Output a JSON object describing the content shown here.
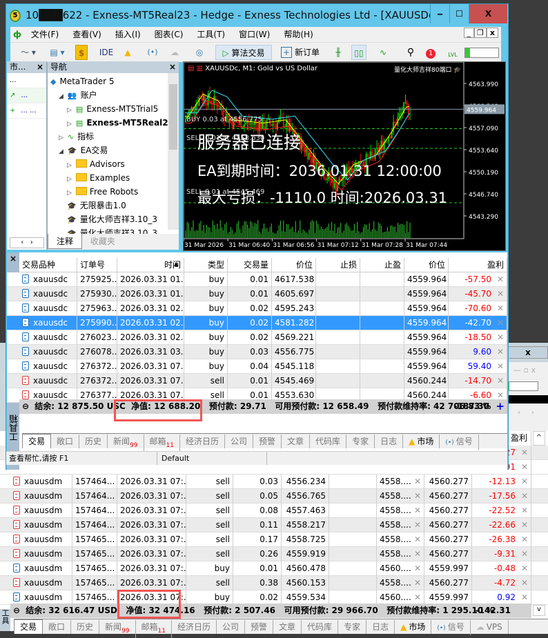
{
  "window": {
    "title": "10███622 - Exness-MT5Real23 - Hedge - Exness Technologies Ltd - [XAUUSDc,...",
    "min": "‒",
    "max": "☐",
    "close": "X"
  },
  "menu": [
    "文件(F)",
    "查看(V)",
    "插入(I)",
    "图表(C)",
    "工具(T)",
    "窗口(W)",
    "帮助(H)"
  ],
  "toolbar": {
    "ide": "IDE",
    "algo": "算法交易",
    "new_order": "新订单",
    "lvl": "LVL",
    "notif_count": "1",
    "level_fill_pct": 15
  },
  "market_watch": {
    "title": "市...",
    "rows": [
      [
        "...",
        ""
      ],
      [
        "↗",
        "..."
      ],
      [
        "+",
        "... ..."
      ]
    ]
  },
  "navigator": {
    "title": "导航",
    "tabs": [
      "注释",
      "收藏夹"
    ],
    "items": [
      {
        "label": "MetaTrader 5",
        "icon": "mt5-logo-icon",
        "level": 0
      },
      {
        "label": "账户",
        "icon": "accounts-icon",
        "level": 1,
        "expand": "◢"
      },
      {
        "label": "Exness-MT5Trial5",
        "icon": "server-icon",
        "level": 2,
        "expand": "▷"
      },
      {
        "label": "Exness-MT5Real2",
        "icon": "server-icon",
        "level": 2,
        "expand": "▷",
        "bold": true
      },
      {
        "label": "指标",
        "icon": "indicator-icon",
        "level": 1,
        "expand": "▷"
      },
      {
        "label": "EA交易",
        "icon": "expert-hat-icon",
        "level": 1,
        "expand": "◢"
      },
      {
        "label": "Advisors",
        "icon": "folder-icon",
        "level": 2,
        "expand": "▷"
      },
      {
        "label": "Examples",
        "icon": "folder-icon",
        "level": 2,
        "expand": "▷"
      },
      {
        "label": "Free Robots",
        "icon": "folder-icon",
        "level": 2,
        "expand": "▷"
      },
      {
        "label": "无限暴击1.0",
        "icon": "expert-hat-icon",
        "level": 2
      },
      {
        "label": "量化大师吉祥3.10_3",
        "icon": "expert-hat-icon",
        "level": 2
      },
      {
        "label": "量化大师吉祥3.10_3",
        "icon": "expert-hat-icon",
        "level": 2
      }
    ]
  },
  "chart": {
    "symbol_title": "XAUUSDc, M1:  Gold vs US Dollar",
    "ea_name": "量化大师吉祥80端口",
    "current_price": "4559.964",
    "price_labels": [
      "4563.990",
      "4560.540",
      "4557.090",
      "4553.640",
      "4550.190",
      "4546.740",
      "4543.290"
    ],
    "time_labels": [
      "31 Mar 2026",
      "31 Mar 06:40",
      "31 Mar 06:56",
      "31 Mar 07:12",
      "31 Mar 07:28",
      "31 Mar 07:44"
    ],
    "order_lines": [
      "BUY 0.03 at 4556.775",
      "SELL 0.01 at 4553.630",
      "SELL 0.01 at 4545.469"
    ],
    "overlay": {
      "status": "服务器已连接",
      "expiry": "EA到期时间：2036.01.31 12:00:00",
      "max_loss": "最大亏损：-1110.0 时间:2026.03.31"
    },
    "colors": {
      "bull": "#00e000",
      "bear": "#ff1010",
      "ma_fast": "#ffff00",
      "ma_mid": "#ff2020",
      "ma_slow": "#30e0ff"
    }
  },
  "toolbox": {
    "side_label": "工具箱",
    "columns": [
      "交易品种",
      "订单号",
      "时间",
      "类型",
      "交易量",
      "价位",
      "止损",
      "止盈",
      "价位",
      "盈利"
    ],
    "rows": [
      {
        "side": "buy",
        "symbol": "xauusdc",
        "order": "275925...",
        "time": "2026.03.31 01...",
        "type": "buy",
        "volume": "0.01",
        "open": "4617.538",
        "sl": "",
        "tp": "",
        "price": "4559.964",
        "profit": "-57.50"
      },
      {
        "side": "buy",
        "symbol": "xauusdc",
        "order": "275930...",
        "time": "2026.03.31 01...",
        "type": "buy",
        "volume": "0.01",
        "open": "4605.697",
        "sl": "",
        "tp": "",
        "price": "4559.964",
        "profit": "-45.70"
      },
      {
        "side": "buy",
        "symbol": "xauusdc",
        "order": "275963...",
        "time": "2026.03.31 02...",
        "type": "buy",
        "volume": "0.02",
        "open": "4595.243",
        "sl": "",
        "tp": "",
        "price": "4559.964",
        "profit": "-70.60"
      },
      {
        "side": "buy",
        "symbol": "xauusdc",
        "order": "275990...",
        "time": "2026.03.31 02...",
        "type": "buy",
        "volume": "0.02",
        "open": "4581.282",
        "sl": "",
        "tp": "",
        "price": "4559.964",
        "profit": "-42.70",
        "selected": true
      },
      {
        "side": "buy",
        "symbol": "xauusdc",
        "order": "276023...",
        "time": "2026.03.31 02...",
        "type": "buy",
        "volume": "0.02",
        "open": "4569.221",
        "sl": "",
        "tp": "",
        "price": "4559.964",
        "profit": "-18.50"
      },
      {
        "side": "buy",
        "symbol": "xauusdc",
        "order": "276078...",
        "time": "2026.03.31 03...",
        "type": "buy",
        "volume": "0.03",
        "open": "4556.775",
        "sl": "",
        "tp": "",
        "price": "4559.964",
        "profit": "9.60"
      },
      {
        "side": "buy",
        "symbol": "xauusdc",
        "order": "276372...",
        "time": "2026.03.31 07...",
        "type": "buy",
        "volume": "0.04",
        "open": "4545.118",
        "sl": "",
        "tp": "",
        "price": "4559.964",
        "profit": "59.40"
      },
      {
        "side": "sell",
        "symbol": "xauusdc",
        "order": "276372...",
        "time": "2026.03.31 07...",
        "type": "sell",
        "volume": "0.01",
        "open": "4545.469",
        "sl": "",
        "tp": "",
        "price": "4560.244",
        "profit": "-14.70"
      },
      {
        "side": "sell",
        "symbol": "xauusdc",
        "order": "276377...",
        "time": "2026.03.31 07...",
        "type": "sell",
        "volume": "0.01",
        "open": "4553.630",
        "sl": "",
        "tp": "",
        "price": "4560.244",
        "profit": "-6.60"
      }
    ],
    "footer": {
      "balance": "结余: 12 875.50 USC",
      "equity": "净值: 12 688.20",
      "margin": "预付款: 29.71",
      "free_margin": "可用预付款: 12 658.49",
      "margin_level": "预付款维持率: 42 706.83 %",
      "total": "-187.30"
    },
    "tabs": [
      {
        "label": "交易"
      },
      {
        "label": "敞口"
      },
      {
        "label": "历史"
      },
      {
        "label": "新闻",
        "badge": "99"
      },
      {
        "label": "邮箱",
        "badge": "11"
      },
      {
        "label": "经济日历"
      },
      {
        "label": "公司"
      },
      {
        "label": "预警"
      },
      {
        "label": "文章"
      },
      {
        "label": "代码库"
      },
      {
        "label": "专家"
      },
      {
        "label": "日志"
      },
      {
        "label": "市场"
      },
      {
        "label": "信号"
      }
    ],
    "status": {
      "help": "查看帮忙,请按 F1",
      "profile": "Default"
    }
  },
  "back_window": {
    "profit_header": "盈利",
    "partial_rows": [
      "27",
      "91"
    ],
    "rows": [
      {
        "side": "sell",
        "symbol": "xauusdm",
        "order": "157464...",
        "time": "2026.03.31 07:...",
        "type": "sell",
        "volume": "0.03",
        "open": "4556.234",
        "sl": "",
        "tp": "4558....",
        "price": "4560.277",
        "profit": "-12.13"
      },
      {
        "side": "sell",
        "symbol": "xauusdm",
        "order": "157464...",
        "time": "2026.03.31 07:...",
        "type": "sell",
        "volume": "0.05",
        "open": "4556.765",
        "sl": "",
        "tp": "4558....",
        "price": "4560.277",
        "profit": "-17.56"
      },
      {
        "side": "sell",
        "symbol": "xauusdm",
        "order": "157464...",
        "time": "2026.03.31 07:...",
        "type": "sell",
        "volume": "0.08",
        "open": "4557.463",
        "sl": "",
        "tp": "4558....",
        "price": "4560.277",
        "profit": "-22.52"
      },
      {
        "side": "sell",
        "symbol": "xauusdm",
        "order": "157464...",
        "time": "2026.03.31 07:...",
        "type": "sell",
        "volume": "0.11",
        "open": "4558.217",
        "sl": "",
        "tp": "4558....",
        "price": "4560.277",
        "profit": "-22.66"
      },
      {
        "side": "sell",
        "symbol": "xauusdm",
        "order": "157465...",
        "time": "2026.03.31 07:...",
        "type": "sell",
        "volume": "0.17",
        "open": "4558.725",
        "sl": "",
        "tp": "4558....",
        "price": "4560.277",
        "profit": "-26.38"
      },
      {
        "side": "sell",
        "symbol": "xauusdm",
        "order": "157465...",
        "time": "2026.03.31 07:...",
        "type": "sell",
        "volume": "0.26",
        "open": "4559.919",
        "sl": "",
        "tp": "4558....",
        "price": "4560.277",
        "profit": "-9.31"
      },
      {
        "side": "buy",
        "symbol": "xauusdm",
        "order": "157465...",
        "time": "2026.03.31 07:...",
        "type": "buy",
        "volume": "0.01",
        "open": "4560.478",
        "sl": "",
        "tp": "4560....",
        "price": "4559.997",
        "profit": "-0.48"
      },
      {
        "side": "sell",
        "symbol": "xauusdm",
        "order": "157465...",
        "time": "2026.03.31 07:...",
        "type": "sell",
        "volume": "0.38",
        "open": "4560.153",
        "sl": "",
        "tp": "4558....",
        "price": "4560.277",
        "profit": "-4.72"
      },
      {
        "side": "buy",
        "symbol": "xauusdm",
        "order": "157465...",
        "time": "2026.03.31 07:...",
        "type": "buy",
        "volume": "0.02",
        "open": "4559.534",
        "sl": "",
        "tp": "4560....",
        "price": "4559.997",
        "profit": "0.92"
      }
    ],
    "footer": {
      "balance": "结余: 32 616.47 USD",
      "equity": "净值: 32 474.16",
      "margin": "预付款: 2 507.46",
      "free_margin": "可用预付款: 29 966.70",
      "margin_level": "预付款维持率: 1 295.10 %",
      "total": "-142.31"
    },
    "tabs": [
      {
        "label": "交易"
      },
      {
        "label": "敞口"
      },
      {
        "label": "历史"
      },
      {
        "label": "新闻",
        "badge": "99"
      },
      {
        "label": "邮箱",
        "badge": "11"
      },
      {
        "label": "经济日历"
      },
      {
        "label": "公司"
      },
      {
        "label": "预警"
      },
      {
        "label": "文章"
      },
      {
        "label": "代码库"
      },
      {
        "label": "专家"
      },
      {
        "label": "日志"
      },
      {
        "label": "市场"
      },
      {
        "label": "信号"
      },
      {
        "label": "VPS"
      }
    ]
  },
  "highlight_color": "#f25555"
}
